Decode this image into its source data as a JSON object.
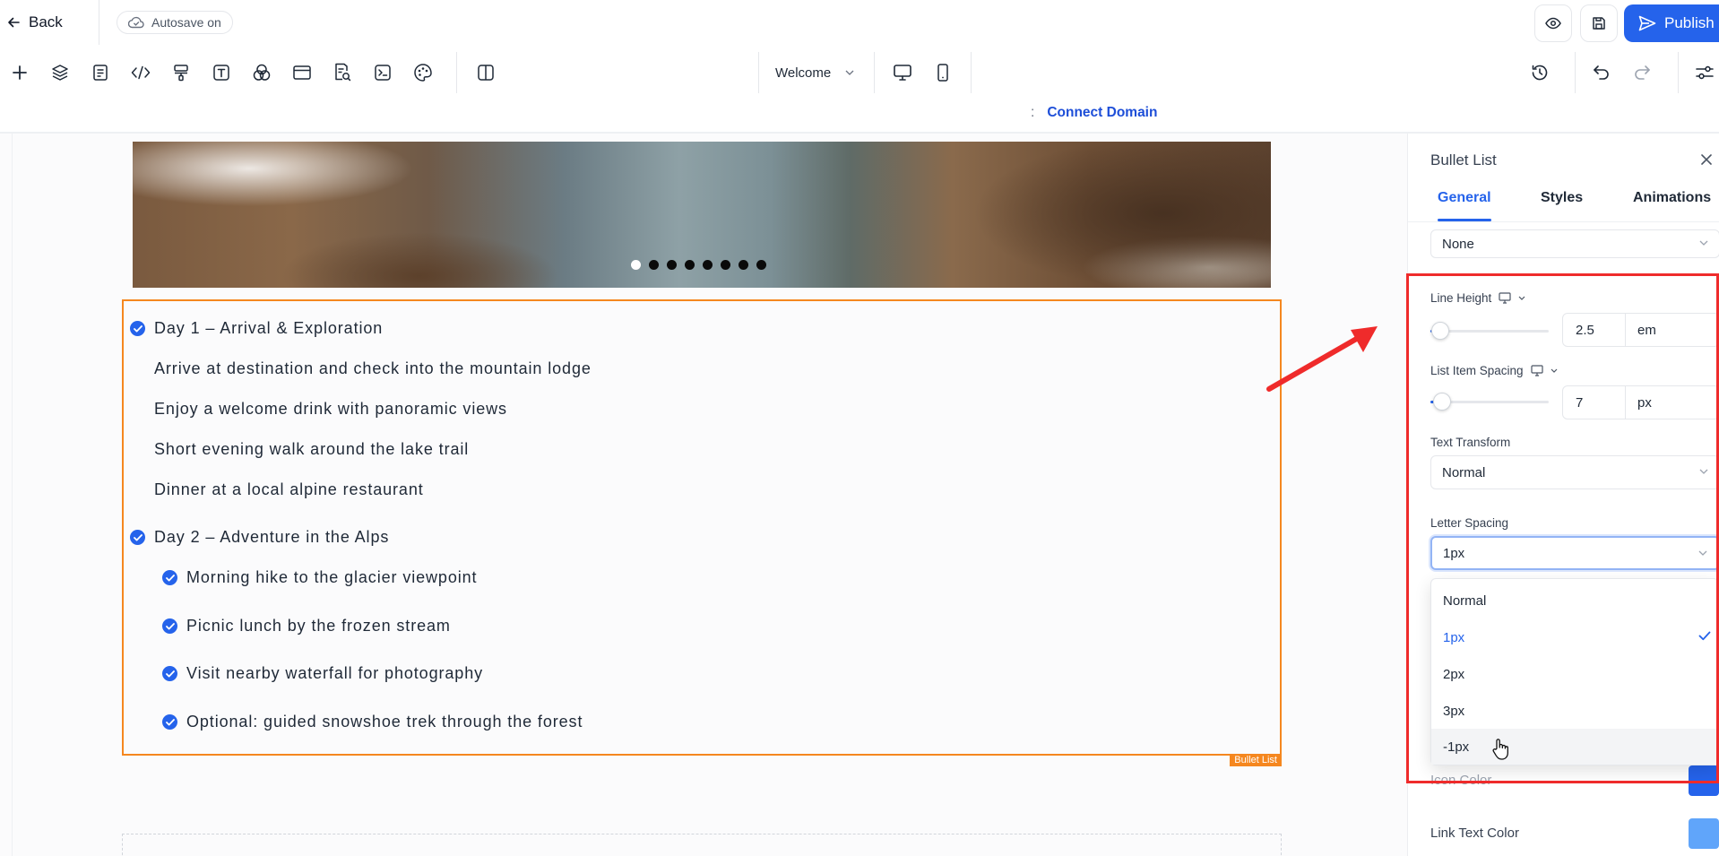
{
  "header": {
    "back_label": "Back",
    "autosave_label": "Autosave on",
    "preview_icon": "eye-icon",
    "save_icon": "save-icon",
    "publish_label": "Publish"
  },
  "toolbar": {
    "icons": [
      "plus-icon",
      "layers-icon",
      "pages-icon",
      "code-icon",
      "paint-roller-icon",
      "text-icon",
      "elements-icon",
      "section-icon",
      "page-search-icon",
      "terminal-icon",
      "palette-icon",
      "columns-icon"
    ],
    "page_selector": "Welcome",
    "history_icon": "history-icon",
    "undo_icon": "undo-icon",
    "redo_icon": "redo-icon",
    "settings_icon": "settings-sliders-icon"
  },
  "domain_bar": {
    "separator": ":",
    "connect_label": "Connect Domain"
  },
  "canvas": {
    "carousel": {
      "dot_count": 8,
      "active_dot": 0
    },
    "bullet_list": {
      "tag": "Bullet List",
      "day1": {
        "title": "Day 1 – Arrival & Exploration",
        "items": [
          "Arrive at destination and check into the mountain lodge",
          "Enjoy a welcome drink with panoramic views",
          "Short evening walk around the lake trail",
          "Dinner at a local alpine restaurant"
        ]
      },
      "day2": {
        "title": "Day 2 – Adventure in the Alps",
        "items": [
          "Morning hike to the glacier viewpoint",
          "Picnic lunch by the frozen stream",
          "Visit nearby waterfall for photography",
          "Optional: guided snowshoe trek through the forest"
        ]
      }
    }
  },
  "panel": {
    "title": "Bullet List",
    "tabs": [
      "General",
      "Styles",
      "Animations"
    ],
    "active_tab": "General",
    "top_select_value": "None",
    "line_height": {
      "label": "Line Height",
      "value": "2.5",
      "unit": "em",
      "slider_fraction": 0.08
    },
    "list_item_spacing": {
      "label": "List Item Spacing",
      "value": "7",
      "unit": "px",
      "slider_fraction": 0.1
    },
    "text_transform": {
      "label": "Text Transform",
      "value": "Normal"
    },
    "letter_spacing": {
      "label": "Letter Spacing",
      "value": "1px",
      "options": [
        "Normal",
        "1px",
        "2px",
        "3px",
        "-1px"
      ],
      "selected_option": "1px",
      "hovered_option": "-1px"
    },
    "icon_color": {
      "label": "Icon Color",
      "color": "#2563eb"
    },
    "link_text_color": {
      "label": "Link Text Color",
      "color": "#60a5fa"
    }
  },
  "colors": {
    "accent": "#2563eb",
    "selection_outline": "#f5871f",
    "annotation_red": "#ef2b2b"
  }
}
